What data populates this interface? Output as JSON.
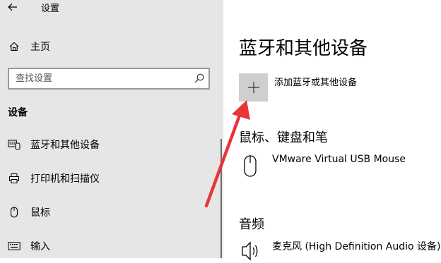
{
  "window": {
    "title": "设置"
  },
  "sidebar": {
    "home_label": "主页",
    "search_placeholder": "查找设置",
    "section_heading": "设备",
    "items": [
      {
        "label": "蓝牙和其他设备",
        "icon": "bluetooth-devices-icon"
      },
      {
        "label": "打印机和扫描仪",
        "icon": "printer-icon"
      },
      {
        "label": "鼠标",
        "icon": "mouse-icon"
      },
      {
        "label": "输入",
        "icon": "keyboard-icon"
      }
    ]
  },
  "main": {
    "title": "蓝牙和其他设备",
    "add_device_label": "添加蓝牙或其他设备",
    "mouse_section": {
      "heading": "鼠标、键盘和笔",
      "devices": [
        {
          "name": "VMware Virtual USB Mouse",
          "icon": "mouse-icon"
        }
      ]
    },
    "audio_section": {
      "heading": "音频",
      "devices": [
        {
          "name": "麦克风 (High Definition Audio 设备)",
          "icon": "speaker-icon"
        }
      ]
    }
  },
  "colors": {
    "sidebar_bg": "#e6e6e6",
    "add_tile_bg": "#cfcfcf",
    "annotation_arrow": "#e8343a"
  }
}
